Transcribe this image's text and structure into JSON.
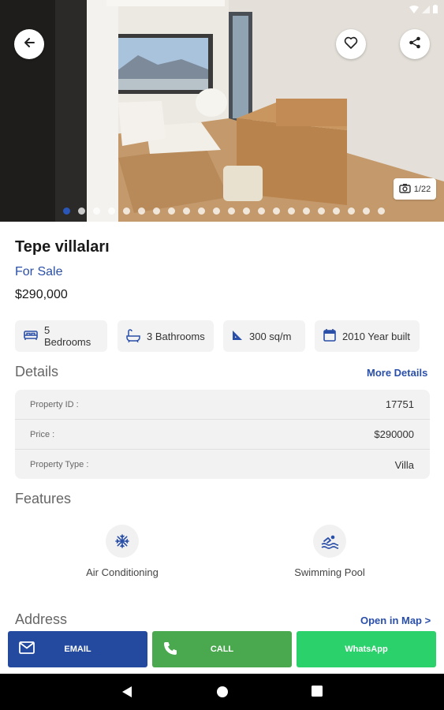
{
  "hero": {
    "photo_counter": "1/22",
    "dots_total": 22,
    "dots_active_index": 0,
    "icons": {
      "back": "arrow-left-icon",
      "favorite": "heart-outline-icon",
      "share": "share-icon",
      "camera": "camera-icon"
    }
  },
  "listing": {
    "title": "Tepe villaları",
    "status": "For Sale",
    "price": "$290,000"
  },
  "chips": [
    {
      "icon": "bed-icon",
      "label": "5 Bedrooms"
    },
    {
      "icon": "bathtub-icon",
      "label": "3 Bathrooms"
    },
    {
      "icon": "area-icon",
      "label": "300 sq/m"
    },
    {
      "icon": "calendar-icon",
      "label": "2010 Year built"
    }
  ],
  "details": {
    "title": "Details",
    "more_link": "More Details",
    "rows": [
      {
        "label": "Property ID :",
        "value": "17751"
      },
      {
        "label": "Price :",
        "value": "$290000"
      },
      {
        "label": "Property Type :",
        "value": "Villa"
      }
    ]
  },
  "features": {
    "title": "Features",
    "items": [
      {
        "icon": "snowflake-icon",
        "label": "Air Conditioning"
      },
      {
        "icon": "swimming-pool-icon",
        "label": "Swimming Pool"
      }
    ]
  },
  "address": {
    "title": "Address",
    "map_link": "Open in Map >"
  },
  "actions": {
    "email": "EMAIL",
    "call": "CALL",
    "whatsapp": "WhatsApp"
  },
  "colors": {
    "accent": "#2a4fa8",
    "email_button": "#234a9f",
    "call_button": "#4aa84f",
    "whatsapp_button": "#2bd16a"
  }
}
